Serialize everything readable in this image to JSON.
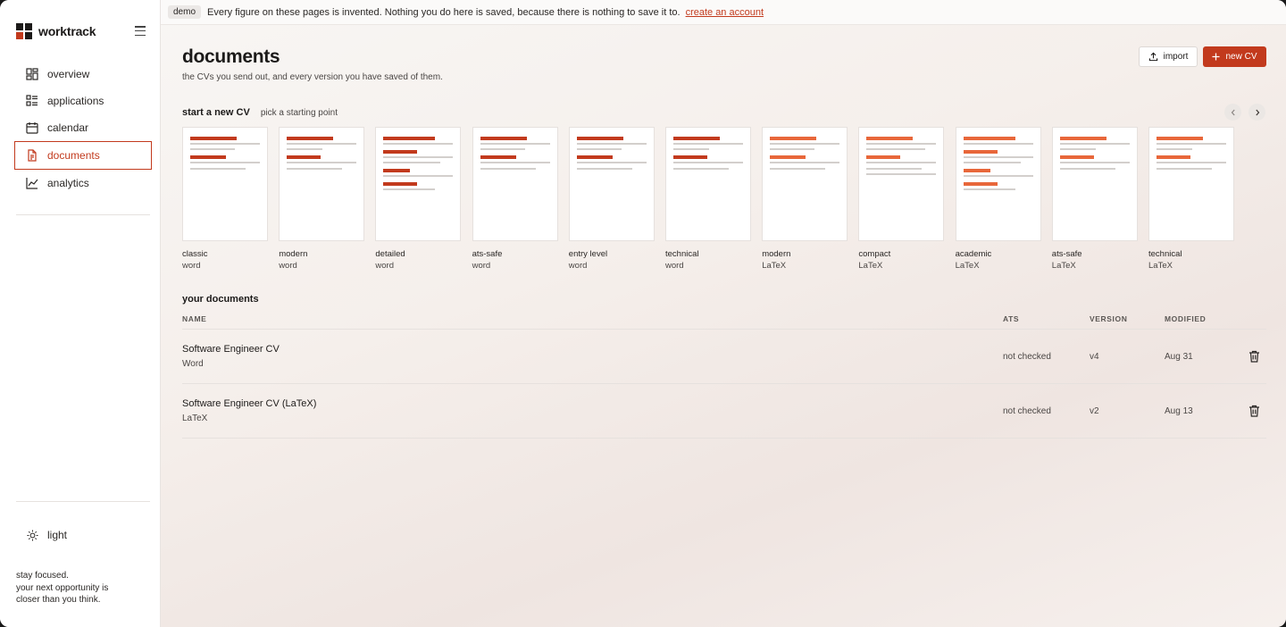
{
  "app": {
    "name": "worktrack"
  },
  "colors": {
    "accent": "#c23a1d",
    "accent_latex": "#e8673a"
  },
  "sidebar": {
    "items": [
      {
        "label": "overview",
        "icon": "grid-icon"
      },
      {
        "label": "applications",
        "icon": "list-icon"
      },
      {
        "label": "calendar",
        "icon": "calendar-icon"
      },
      {
        "label": "documents",
        "icon": "document-icon",
        "active": true
      },
      {
        "label": "analytics",
        "icon": "chart-icon"
      }
    ],
    "theme_label": "light",
    "tagline": "stay focused.\nyour next opportunity is\ncloser than you think."
  },
  "banner": {
    "badge": "demo",
    "text": "Every figure on these pages is invented. Nothing you do here is saved, because there is nothing to save it to.",
    "link": "create an account"
  },
  "header": {
    "title": "documents",
    "subtitle": "the CVs you send out, and every version you have saved of them.",
    "import_label": "import",
    "new_label": "new CV"
  },
  "templates_section": {
    "title": "start a new CV",
    "subtitle": "pick a starting point",
    "items": [
      {
        "name": "classic",
        "kind": "word",
        "style": "word",
        "layout": "a"
      },
      {
        "name": "modern",
        "kind": "word",
        "style": "word",
        "layout": "b"
      },
      {
        "name": "detailed",
        "kind": "word",
        "style": "word",
        "layout": "c"
      },
      {
        "name": "ats-safe",
        "kind": "word",
        "style": "word",
        "layout": "a"
      },
      {
        "name": "entry level",
        "kind": "word",
        "style": "word",
        "layout": "a"
      },
      {
        "name": "technical",
        "kind": "word",
        "style": "word",
        "layout": "b"
      },
      {
        "name": "modern",
        "kind": "LaTeX",
        "style": "latex",
        "layout": "a"
      },
      {
        "name": "compact",
        "kind": "LaTeX",
        "style": "latex",
        "layout": "d"
      },
      {
        "name": "academic",
        "kind": "LaTeX",
        "style": "latex",
        "layout": "c"
      },
      {
        "name": "ats-safe",
        "kind": "LaTeX",
        "style": "latex",
        "layout": "b"
      },
      {
        "name": "technical",
        "kind": "LaTeX",
        "style": "latex",
        "layout": "b"
      }
    ]
  },
  "documents": {
    "title": "your documents",
    "columns": {
      "name": "NAME",
      "ats": "ATS",
      "version": "VERSION",
      "modified": "MODIFIED"
    },
    "rows": [
      {
        "name": "Software Engineer CV",
        "kind": "Word",
        "ats": "not checked",
        "version": "v4",
        "modified": "Aug 31"
      },
      {
        "name": "Software Engineer CV (LaTeX)",
        "kind": "LaTeX",
        "ats": "not checked",
        "version": "v2",
        "modified": "Aug 13"
      }
    ]
  }
}
